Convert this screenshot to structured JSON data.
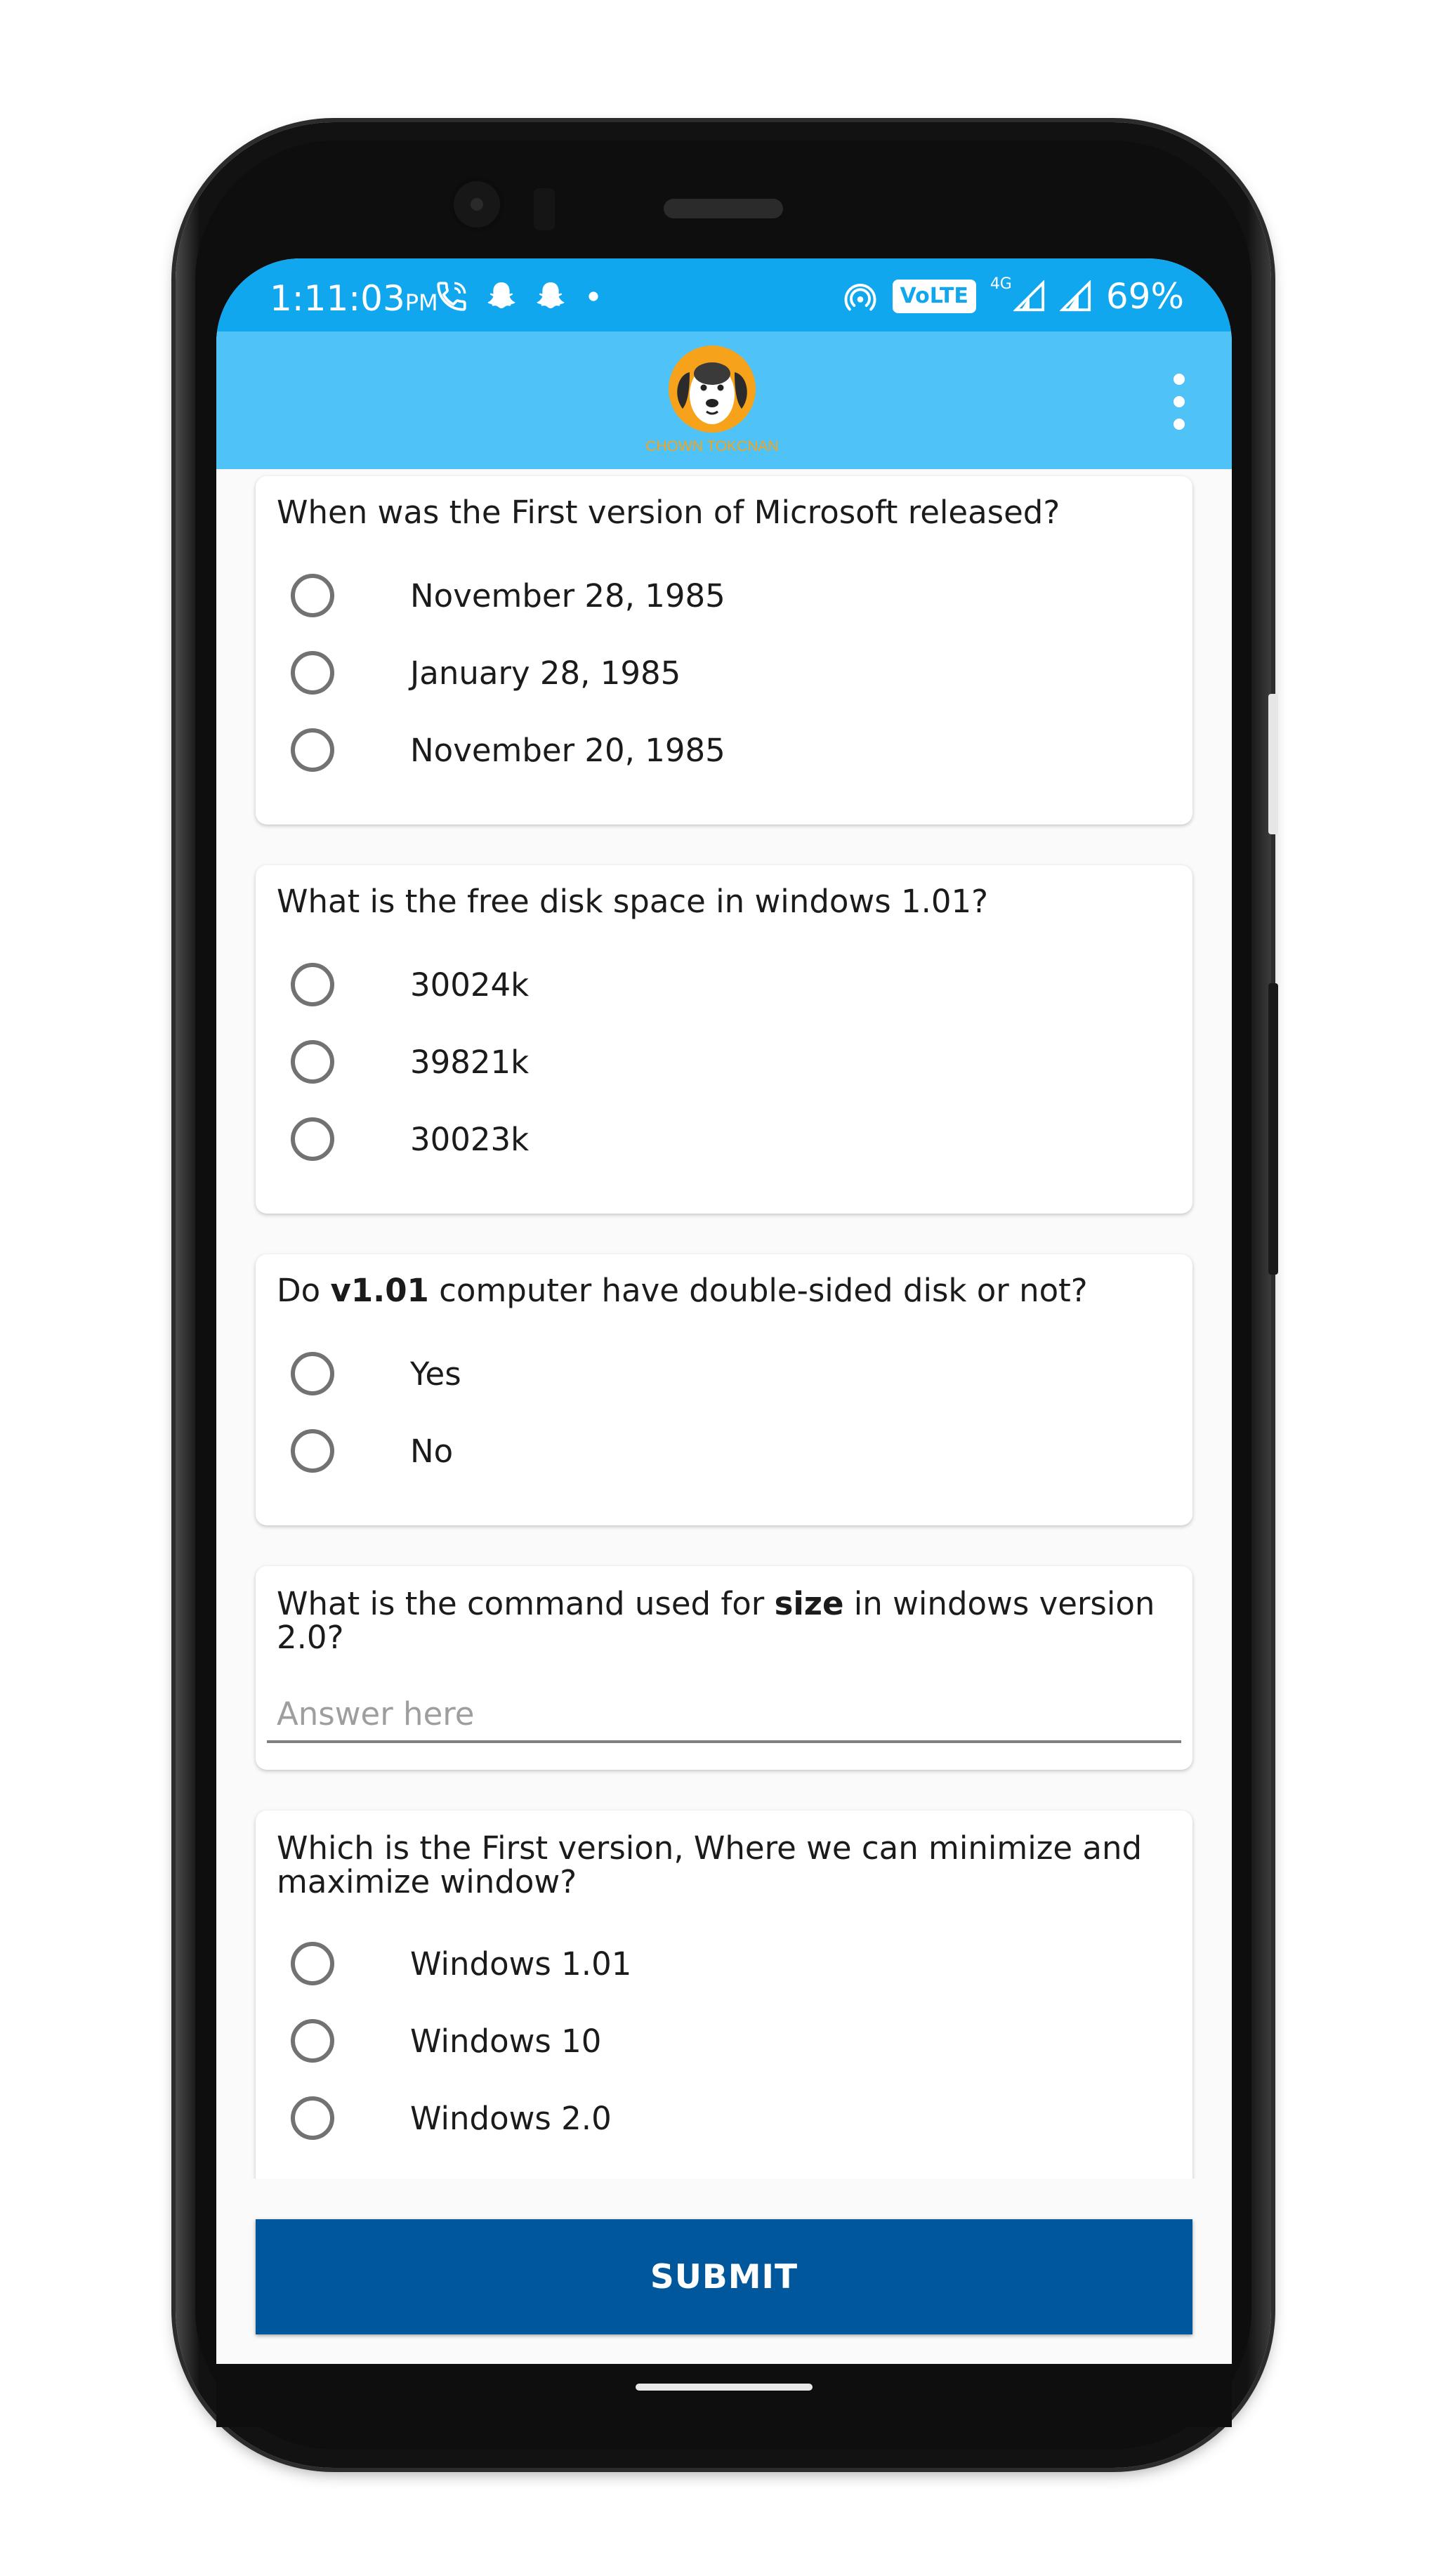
{
  "status_bar": {
    "time": "1:11:03",
    "ampm": "PM",
    "network_badge": "VoLTE",
    "network_type": "4G",
    "battery": "69%",
    "icons": [
      "wifi-calling-icon",
      "snapchat-icon",
      "snapchat-icon",
      "dot-icon",
      "hotspot-icon",
      "signal-icon",
      "signal-icon"
    ]
  },
  "app_bar": {
    "logo_text": "CHOWN TOKCNAN",
    "logo_icon": "dog-face-icon",
    "menu_icon": "more-vert-icon"
  },
  "questions": [
    {
      "text": "When was the First version of Microsoft released?",
      "options": [
        "November 28, 1985",
        "January 28, 1985",
        "November 20, 1985"
      ]
    },
    {
      "text": "What is the free disk space in windows 1.01?",
      "options": [
        "30024k",
        "39821k",
        "30023k"
      ]
    },
    {
      "text_before": "Do ",
      "text_bold": "v1.01",
      "text_after": " computer have double-sided disk or not?",
      "options": [
        "Yes",
        "No"
      ]
    },
    {
      "text_before": "What is the command used for ",
      "text_bold": "size",
      "text_after": " in windows version 2.0?",
      "placeholder": "Answer here",
      "value": ""
    },
    {
      "text": "Which is the First version, Where we can minimize and maximize window?",
      "options": [
        "Windows 1.01",
        "Windows 10",
        "Windows 2.0"
      ]
    }
  ],
  "submit_label": "SUBMIT",
  "colors": {
    "status_bar": "#10a7ee",
    "app_bar": "#4fc3f7",
    "submit": "#01579b",
    "background": "#fafafa"
  }
}
